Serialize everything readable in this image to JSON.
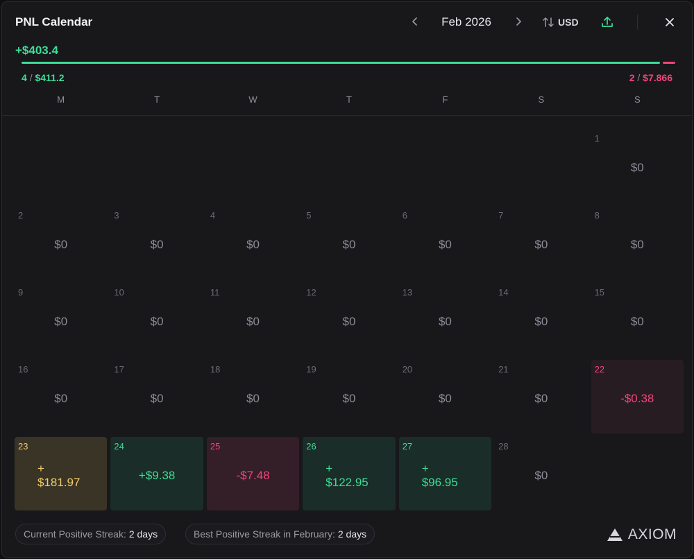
{
  "header": {
    "title": "PNL Calendar",
    "month": "Feb 2026",
    "currency": "USD",
    "icons": {
      "prev": "chevron-left-icon",
      "next": "chevron-right-icon",
      "currency": "sort-arrows-icon",
      "share": "upload-icon",
      "close": "close-icon"
    }
  },
  "summary": {
    "total": "+$403.4",
    "wins_count": "4",
    "wins_value": "$411.2",
    "losses_count": "2",
    "losses_value": "$7.866",
    "positive_fraction": 0.981,
    "colors": {
      "positive": "#3ddc97",
      "negative": "#f2457a",
      "best": "#f0cc6c"
    }
  },
  "weekdays": [
    "M",
    "T",
    "W",
    "T",
    "F",
    "S",
    "S"
  ],
  "days": [
    {
      "n": "",
      "amt": "",
      "kind": "empty"
    },
    {
      "n": "",
      "amt": "",
      "kind": "empty"
    },
    {
      "n": "",
      "amt": "",
      "kind": "empty"
    },
    {
      "n": "",
      "amt": "",
      "kind": "empty"
    },
    {
      "n": "",
      "amt": "",
      "kind": "empty"
    },
    {
      "n": "",
      "amt": "",
      "kind": "empty"
    },
    {
      "n": "1",
      "amt": "$0",
      "kind": "zero"
    },
    {
      "n": "2",
      "amt": "$0",
      "kind": "zero"
    },
    {
      "n": "3",
      "amt": "$0",
      "kind": "zero"
    },
    {
      "n": "4",
      "amt": "$0",
      "kind": "zero"
    },
    {
      "n": "5",
      "amt": "$0",
      "kind": "zero"
    },
    {
      "n": "6",
      "amt": "$0",
      "kind": "zero"
    },
    {
      "n": "7",
      "amt": "$0",
      "kind": "zero"
    },
    {
      "n": "8",
      "amt": "$0",
      "kind": "zero"
    },
    {
      "n": "9",
      "amt": "$0",
      "kind": "zero"
    },
    {
      "n": "10",
      "amt": "$0",
      "kind": "zero"
    },
    {
      "n": "11",
      "amt": "$0",
      "kind": "zero"
    },
    {
      "n": "12",
      "amt": "$0",
      "kind": "zero"
    },
    {
      "n": "13",
      "amt": "$0",
      "kind": "zero"
    },
    {
      "n": "14",
      "amt": "$0",
      "kind": "zero"
    },
    {
      "n": "15",
      "amt": "$0",
      "kind": "zero"
    },
    {
      "n": "16",
      "amt": "$0",
      "kind": "zero"
    },
    {
      "n": "17",
      "amt": "$0",
      "kind": "zero"
    },
    {
      "n": "18",
      "amt": "$0",
      "kind": "zero"
    },
    {
      "n": "19",
      "amt": "$0",
      "kind": "zero"
    },
    {
      "n": "20",
      "amt": "$0",
      "kind": "zero"
    },
    {
      "n": "21",
      "amt": "$0",
      "kind": "zero"
    },
    {
      "n": "22",
      "amt": "-$0.38",
      "kind": "neg faint"
    },
    {
      "n": "23",
      "amt": "$181.97",
      "prefix": "+",
      "kind": "best stack"
    },
    {
      "n": "24",
      "amt": "+$9.38",
      "kind": "pos"
    },
    {
      "n": "25",
      "amt": "-$7.48",
      "kind": "neg"
    },
    {
      "n": "26",
      "amt": "$122.95",
      "prefix": "+",
      "kind": "pos stack"
    },
    {
      "n": "27",
      "amt": "$96.95",
      "prefix": "+",
      "kind": "pos stack"
    },
    {
      "n": "28",
      "amt": "$0",
      "kind": "zero"
    }
  ],
  "footer": {
    "current_streak_label": "Current Positive Streak:",
    "current_streak_value": "2 days",
    "best_streak_label": "Best Positive Streak in February:",
    "best_streak_value": "2 days",
    "logo_text": "AXIOM",
    "logo_icon": "axiom-logo-icon"
  }
}
